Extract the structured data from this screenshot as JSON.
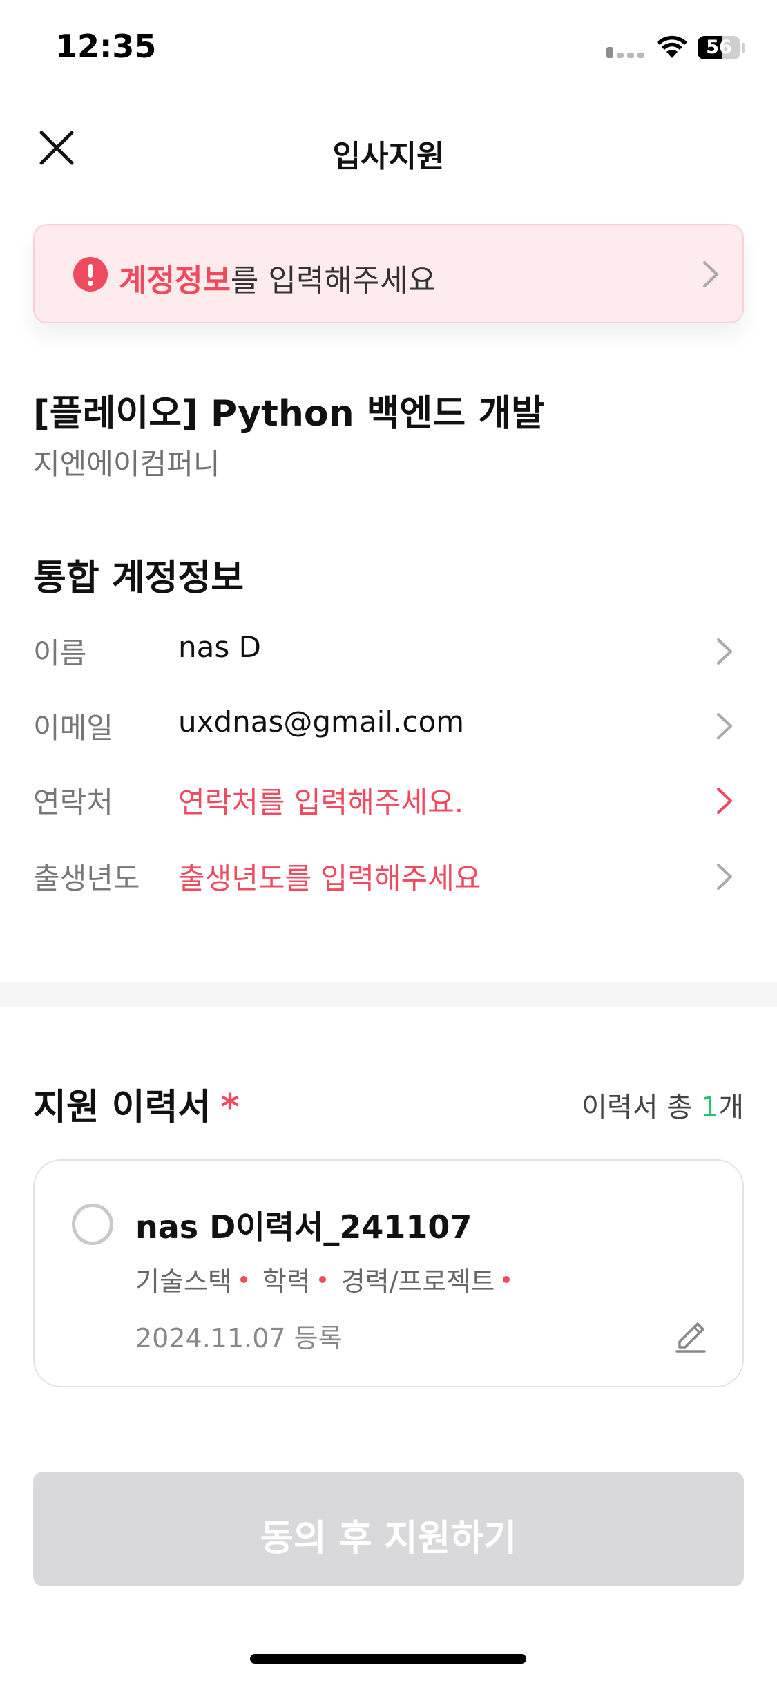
{
  "status_bar": {
    "time": "12:35",
    "battery": 56,
    "battery_text": "56"
  },
  "header": {
    "title": "입사지원"
  },
  "alert": {
    "highlight": "계정정보",
    "message": "를 입력해주세요"
  },
  "job": {
    "title": "[플레이오] Python 백엔드 개발",
    "company": "지엔에이컴퍼니"
  },
  "account": {
    "section_title": "통합 계정정보",
    "rows": [
      {
        "label": "이름",
        "value": "nas D",
        "error": false
      },
      {
        "label": "이메일",
        "value": "uxdnas@gmail.com",
        "error": false
      },
      {
        "label": "연락처",
        "value": "연락처를 입력해주세요.",
        "error": true
      },
      {
        "label": "출생년도",
        "value": "출생년도를 입력해주세요",
        "error": true
      }
    ]
  },
  "resume": {
    "section_title": "지원 이력서",
    "required_mark": "*",
    "count_prefix": "이력서 총 ",
    "count": "1",
    "count_suffix": "개",
    "card": {
      "name": "nas D이력서_241107",
      "tags": [
        "기술스택",
        "학력",
        "경력/프로젝트"
      ],
      "date": "2024.11.07 등록"
    }
  },
  "cta": {
    "label": "동의 후 지원하기"
  },
  "colors": {
    "error": "#ef4a5e",
    "count": "#2ac16b",
    "cta_disabled": "#d9d9dc"
  }
}
